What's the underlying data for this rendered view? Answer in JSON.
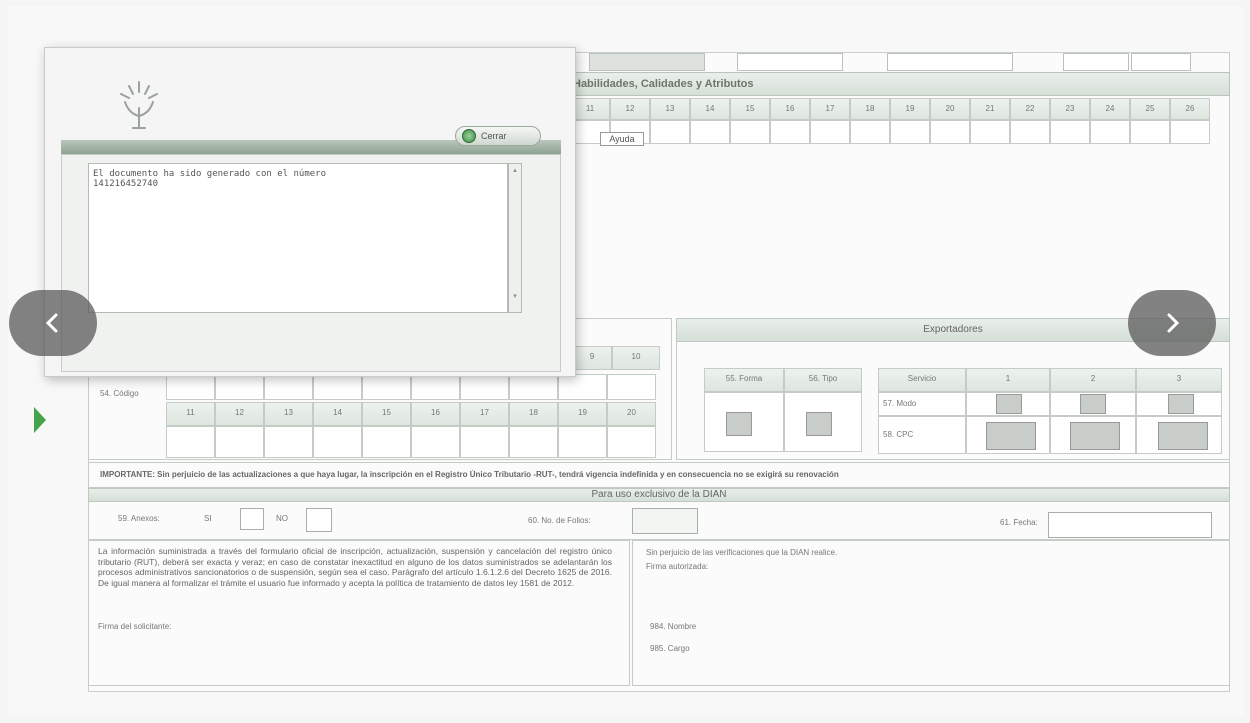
{
  "form": {
    "section_title": "Habilidades, Calidades y Atributos",
    "numbers_top": [
      "11",
      "12",
      "13",
      "14",
      "15",
      "16",
      "17",
      "18",
      "19",
      "20",
      "21",
      "22",
      "23",
      "24",
      "25",
      "26"
    ],
    "ayuda_label": "Ayuda",
    "exportadores_title": "Exportadores",
    "codigo_label": "54. Código",
    "codigo_numbers_top": [
      "9",
      "10"
    ],
    "codigo_numbers_bottom": [
      "11",
      "12",
      "13",
      "14",
      "15",
      "16",
      "17",
      "18",
      "19",
      "20"
    ],
    "forma_label": "55. Forma",
    "tipo_label": "56. Tipo",
    "servicio_label": "Servicio",
    "servicio_cols": [
      "1",
      "2",
      "3"
    ],
    "modo_label": "57. Modo",
    "cpc_label": "58. CPC",
    "importante_text": "IMPORTANTE: Sin perjuicio de las actualizaciones a que haya lugar, la inscripción en el Registro Único Tributario -RUT-, tendrá vigencia indefinida y en consecuencia no se exigirá su renovación",
    "dian_title": "Para uso exclusivo de la DIAN",
    "anexos_label": "59. Anexos:",
    "si_label": "SI",
    "no_label": "NO",
    "folios_label": "60. No. de Folios:",
    "fecha_label": "61. Fecha:",
    "info_text": "La información suministrada a través del formulario oficial de inscripción, actualización, suspensión y cancelación del registro único tributario (RUT), deberá ser exacta y veraz; en caso de constatar inexactitud en alguno de los datos suministrados se adelantarán los procesos administrativos sancionatorios o de suspensión, según sea el caso. Parágrafo del artículo 1.6.1.2.6 del Decreto 1625 de 2016. De igual manera al formalizar el trámite el usuario fue informado y acepta la política de tratamiento de datos ley 1581 de 2012.",
    "firma_solicitante": "Firma del solicitante:",
    "verificaciones_text": "Sin perjuicio de las verificaciones que la DIAN realice.",
    "firma_autorizada": "Firma autorizada:",
    "nombre_label": "984. Nombre",
    "cargo_label": "985. Cargo"
  },
  "dialog": {
    "close_label": "Cerrar",
    "message": "El documento ha sido generado con el número\n14121645274​0"
  },
  "nav": {
    "prev_icon": "chevron-left-icon",
    "next_icon": "chevron-right-icon"
  }
}
